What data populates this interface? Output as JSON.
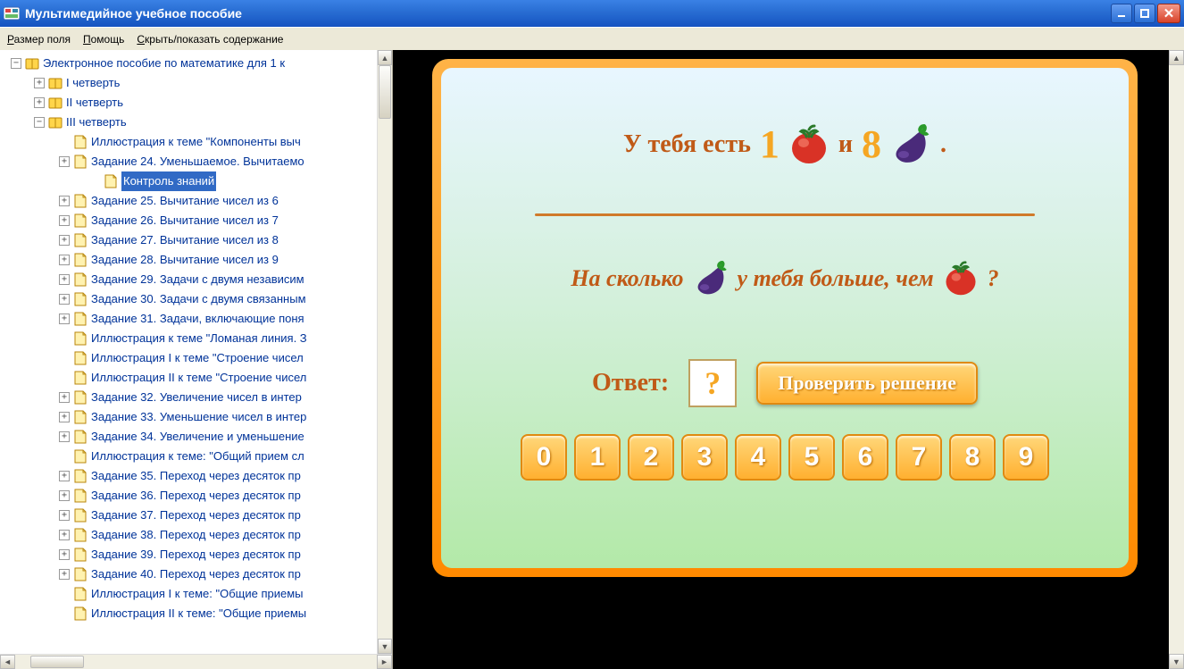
{
  "window": {
    "title": "Мультимедийное учебное пособие"
  },
  "menu": {
    "size": "Размер поля",
    "help": "Помощь",
    "toggle": "Скрыть/показать содержание"
  },
  "tree": {
    "root": "Электронное пособие по математике для 1 к",
    "q1": "I четверть",
    "q2": "II четверть",
    "q3": "III четверть",
    "items": [
      "Иллюстрация к теме \"Компоненты выч",
      "Задание 24. Уменьшаемое. Вычитаемо",
      "Контроль знаний",
      "Задание 25. Вычитание чисел из 6",
      "Задание 26. Вычитание чисел из 7",
      "Задание 27. Вычитание чисел из 8",
      "Задание 28. Вычитание чисел из 9",
      "Задание 29. Задачи с двумя независим",
      "Задание 30. Задачи с двумя связанным",
      "Задание 31. Задачи, включающие поня",
      "Иллюстрация к теме \"Ломаная линия. З",
      "Иллюстрация I к теме \"Строение чисел",
      "Иллюстрация II к теме \"Строение чисел",
      "Задание 32. Увеличение чисел в интер",
      "Задание 33. Уменьшение чисел в интер",
      "Задание 34. Увеличение и уменьшение",
      "Иллюстрация к теме: \"Общий прием сл",
      "Задание 35. Переход через десяток пр",
      "Задание 36. Переход через десяток пр",
      "Задание 37. Переход через десяток пр",
      "Задание 38. Переход через десяток пр",
      "Задание 39. Переход через десяток пр",
      "Задание 40. Переход через десяток пр",
      "Иллюстрация I к теме: \"Общие приемы",
      "Иллюстрация II к теме: \"Общие приемы"
    ]
  },
  "exercise": {
    "line1_a": "У тебя есть",
    "num1": "1",
    "line1_b": "и",
    "num2": "8",
    "line1_c": ".",
    "line2_a": "На сколько",
    "line2_b": "у тебя больше, чем",
    "line2_c": "?",
    "answer_label": "Ответ:",
    "answer_placeholder": "?",
    "check_button": "Проверить решение",
    "digits": [
      "0",
      "1",
      "2",
      "3",
      "4",
      "5",
      "6",
      "7",
      "8",
      "9"
    ]
  }
}
